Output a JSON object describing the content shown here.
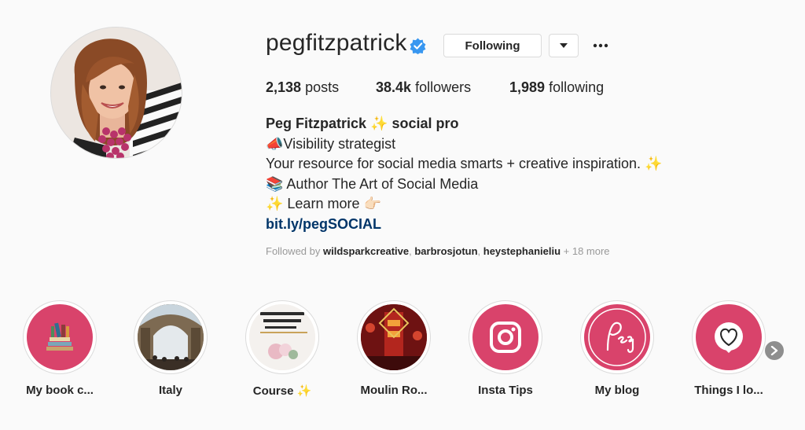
{
  "profile": {
    "username": "pegfitzpatrick",
    "verified": true,
    "follow_button_label": "Following",
    "dropdown_icon": "caret-down-icon",
    "more_icon": "ellipsis-icon",
    "avatar_icon": "profile-avatar"
  },
  "stats": {
    "posts_count": "2,138",
    "posts_label": "posts",
    "followers_count": "38.4k",
    "followers_label": "followers",
    "following_count": "1,989",
    "following_label": "following"
  },
  "bio": {
    "name": "Peg Fitzpatrick ✨ social pro",
    "line1": "📣Visibility strategist",
    "line2": "Your resource for social media smarts + creative inspiration. ✨",
    "line3": "📚 Author The Art of Social Media",
    "line4": "✨ Learn more 👉🏻",
    "link": "bit.ly/pegSOCIAL"
  },
  "followed_by": {
    "prefix": "Followed by",
    "users": [
      "wildsparkcreative",
      "barbrosjotun",
      "heystephanieliu"
    ],
    "sep1": ", ",
    "sep2": ", ",
    "suffix": "+ 18 more"
  },
  "highlights": [
    {
      "label": "My book c...",
      "icon": "books-icon"
    },
    {
      "label": "Italy",
      "icon": "gallery-photo"
    },
    {
      "label": "Course ✨",
      "icon": "pinterest-course-photo"
    },
    {
      "label": "Moulin Ro...",
      "icon": "moulin-rouge-photo"
    },
    {
      "label": "Insta Tips",
      "icon": "instagram-icon"
    },
    {
      "label": "My blog",
      "icon": "peg-script-icon"
    },
    {
      "label": "Things I lo...",
      "icon": "heart-balloon-icon"
    }
  ],
  "highlights_next_icon": "chevron-right-icon",
  "colors": {
    "accent_pink": "#d9436b",
    "link_blue": "#003569",
    "verified_blue": "#3897f0"
  }
}
